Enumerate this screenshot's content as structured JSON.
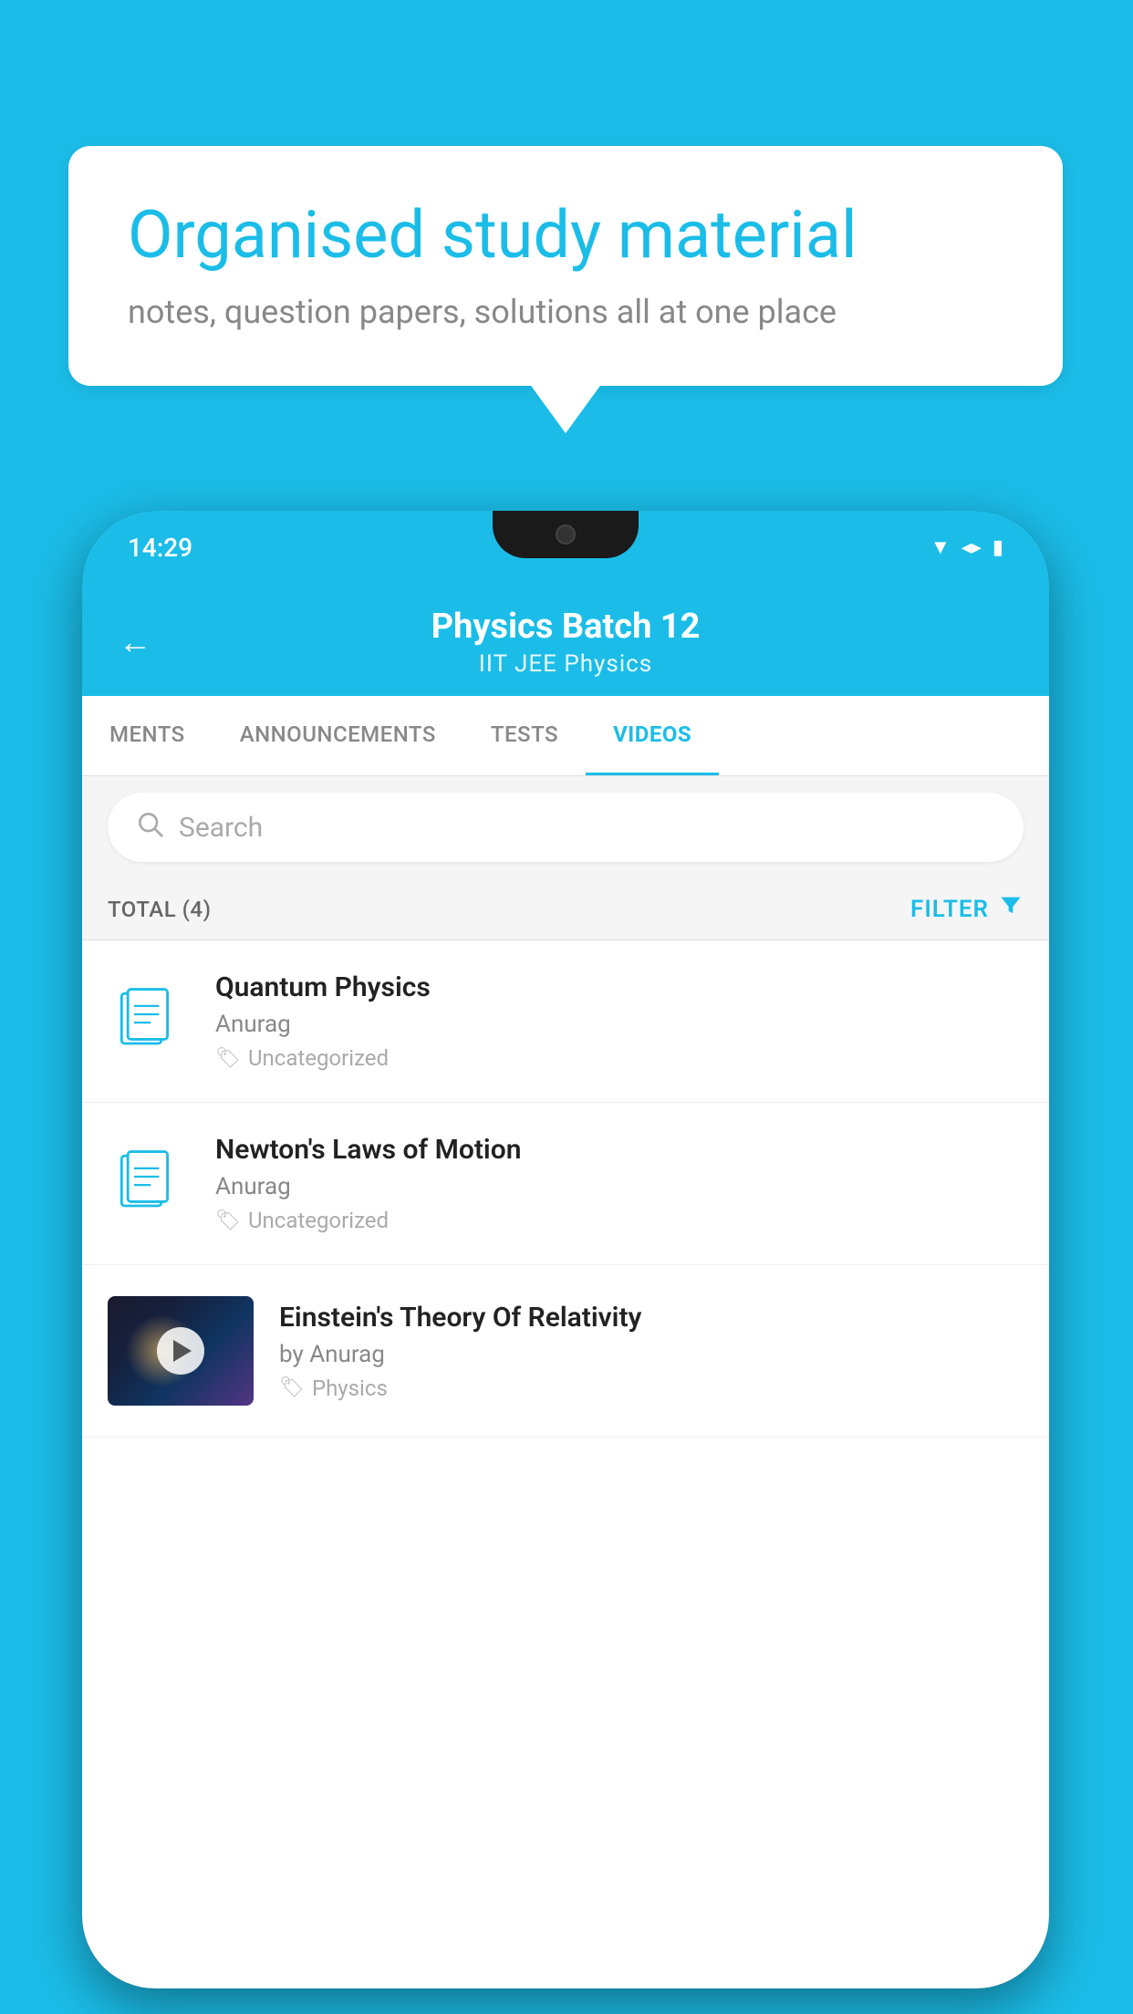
{
  "background": {
    "color": "#1BBDE8"
  },
  "bubble": {
    "title": "Organised study material",
    "subtitle": "notes, question papers, solutions all at one place"
  },
  "phone": {
    "status_bar": {
      "time": "14:29"
    },
    "header": {
      "back_label": "←",
      "title": "Physics Batch 12",
      "subtitle": "IIT JEE   Physics"
    },
    "tabs": [
      {
        "label": "MENTS",
        "active": false
      },
      {
        "label": "ANNOUNCEMENTS",
        "active": false
      },
      {
        "label": "TESTS",
        "active": false
      },
      {
        "label": "VIDEOS",
        "active": true
      }
    ],
    "search": {
      "placeholder": "Search"
    },
    "filter_row": {
      "total_label": "TOTAL (4)",
      "filter_label": "FILTER"
    },
    "videos": [
      {
        "title": "Quantum Physics",
        "author": "Anurag",
        "tag": "Uncategorized",
        "has_thumbnail": false
      },
      {
        "title": "Newton's Laws of Motion",
        "author": "Anurag",
        "tag": "Uncategorized",
        "has_thumbnail": false
      },
      {
        "title": "Einstein's Theory Of Relativity",
        "author": "by Anurag",
        "tag": "Physics",
        "has_thumbnail": true
      }
    ]
  }
}
